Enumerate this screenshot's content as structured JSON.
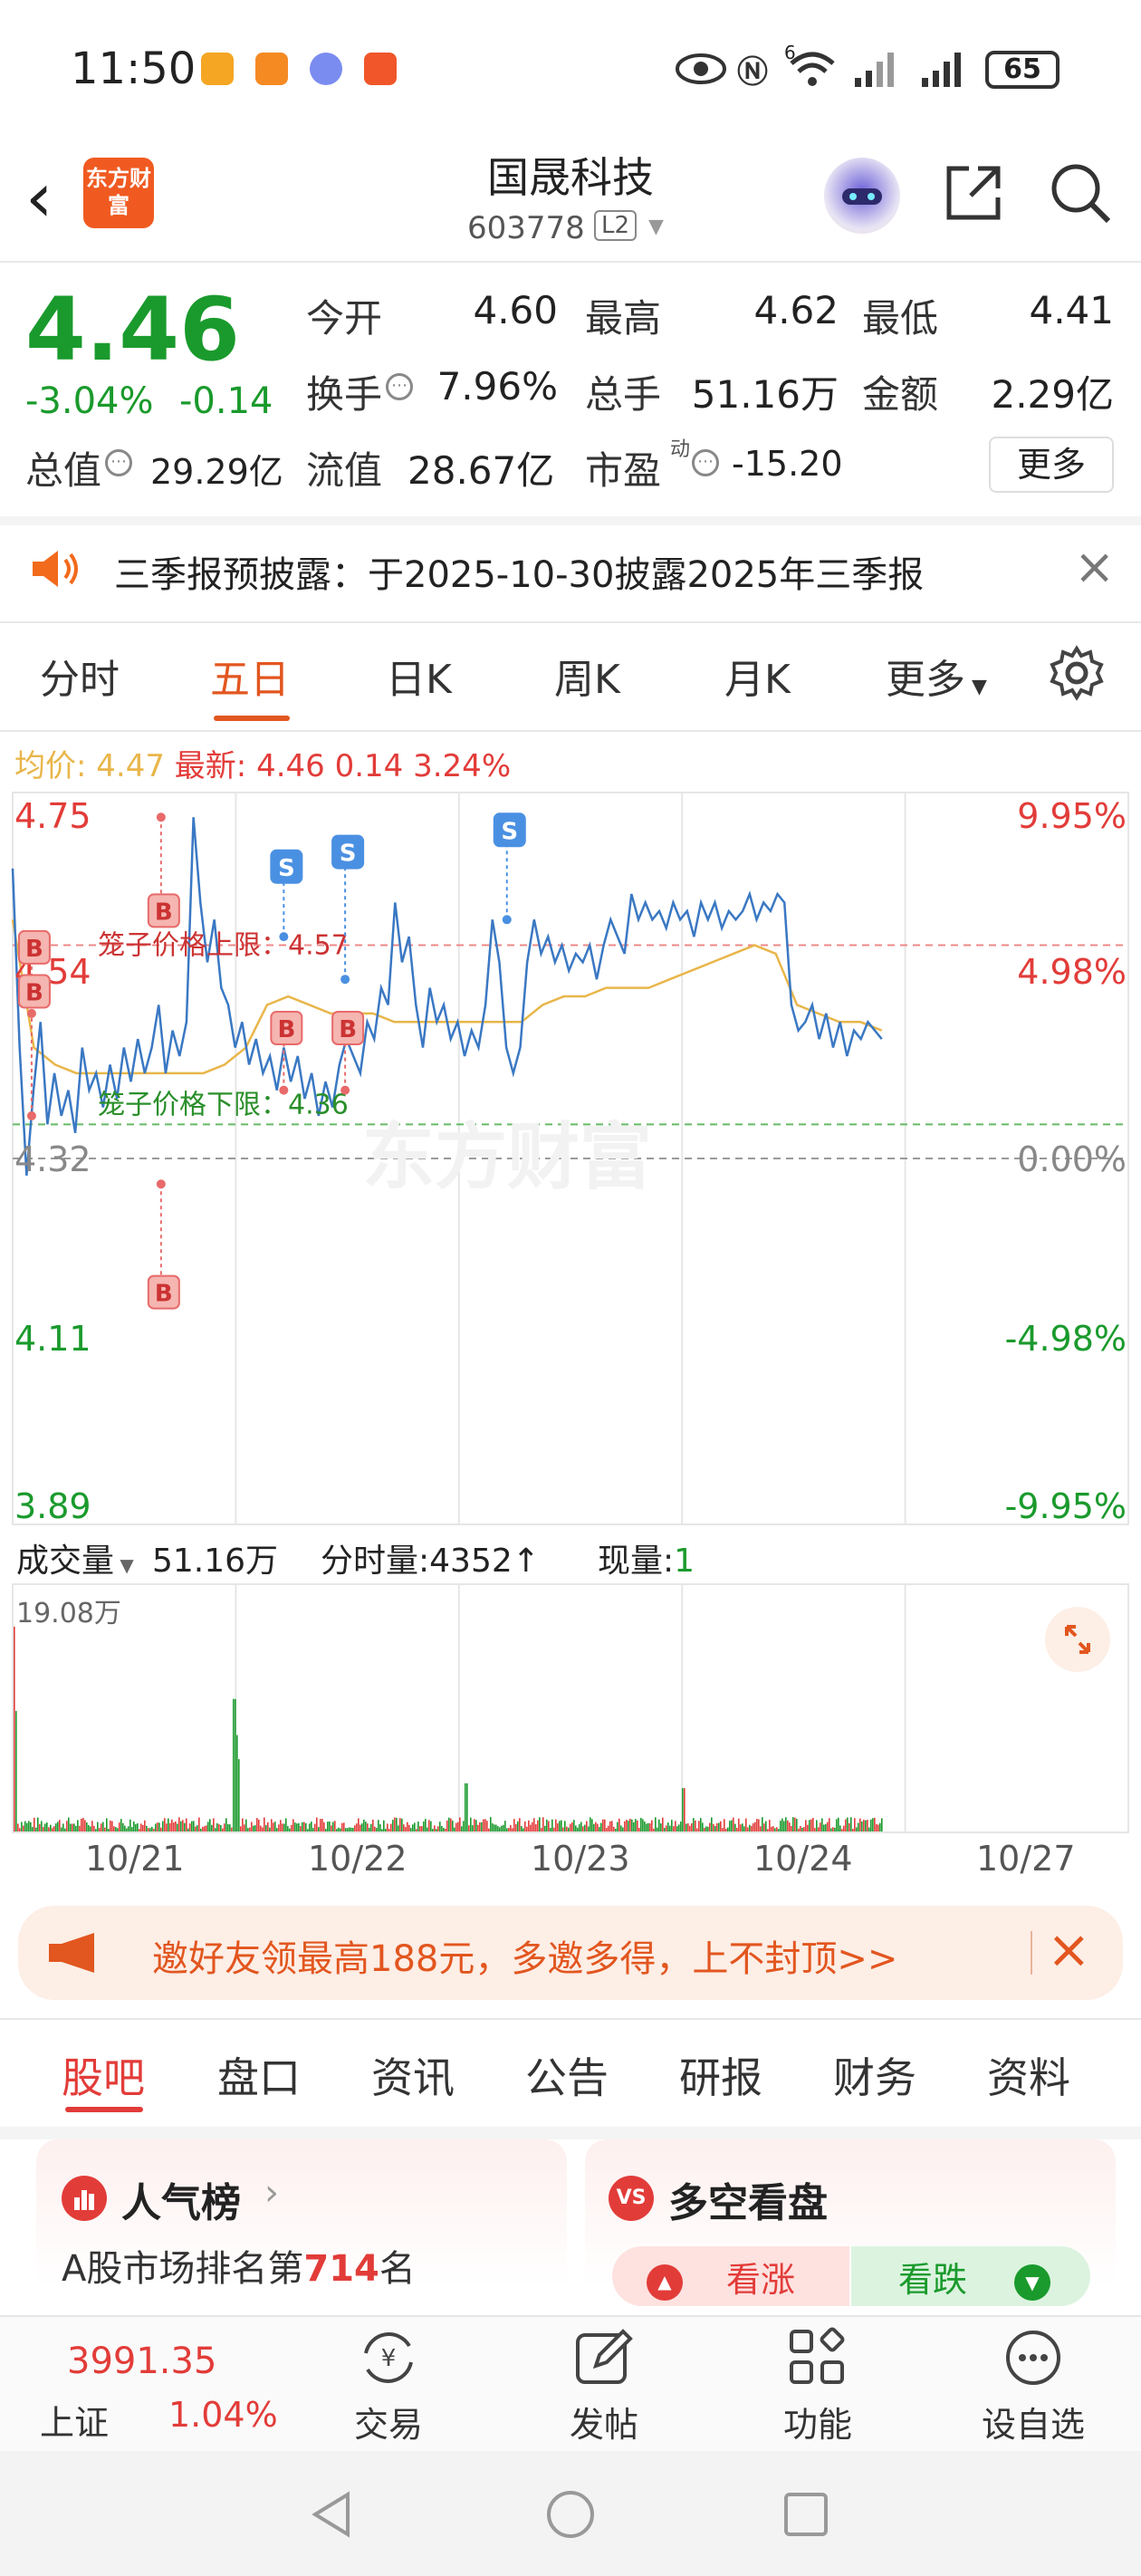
{
  "status_bar": {
    "time": "11:50",
    "network": "6",
    "battery": "65"
  },
  "header": {
    "logo_text": "东方财富",
    "stock_name": "国晟科技",
    "stock_code": "603778",
    "level_badge": "L2"
  },
  "quote": {
    "price": "4.46",
    "change_pct": "-3.04%",
    "change_abs": "-0.14",
    "fields": {
      "open_label": "今开",
      "open": "4.60",
      "high_label": "最高",
      "high": "4.62",
      "low_label": "最低",
      "low": "4.41",
      "turnover_label": "换手",
      "turnover": "7.96%",
      "volume_label": "总手",
      "volume": "51.16万",
      "amount_label": "金额",
      "amount": "2.29亿",
      "mcap_label": "总值",
      "mcap": "29.29亿",
      "float_label": "流值",
      "float": "28.67亿",
      "pe_label": "市盈",
      "pe_sup": "动",
      "pe": "-15.20"
    },
    "more_label": "更多"
  },
  "notice": {
    "text": "三季报预披露：于2025-10-30披露2025年三季报"
  },
  "chart_tabs": [
    "分时",
    "五日",
    "日K",
    "周K",
    "月K",
    "更多"
  ],
  "active_chart_tab": "五日",
  "price_chart": {
    "avg_label": "均价:",
    "avg_value": "4.47",
    "latest_label": "最新:",
    "latest_value": "4.46",
    "latest_change": "0.14",
    "latest_pct": "3.24%",
    "y_labels_left": [
      "4.75",
      "4.54",
      "4.32",
      "4.11",
      "3.89"
    ],
    "y_labels_right": [
      "9.95%",
      "4.98%",
      "0.00%",
      "-4.98%",
      "-9.95%"
    ],
    "upper_cage_label": "笼子价格上限：4.57",
    "lower_cage_label": "笼子价格下限：4.36",
    "watermark": "东方财富"
  },
  "chart_data": {
    "type": "line",
    "title": "",
    "xlabel": "",
    "ylabel": "",
    "x": [
      "10/21",
      "10/22",
      "10/23",
      "10/24",
      "10/27"
    ],
    "ylim": [
      3.89,
      4.75
    ],
    "prev_close": 4.32,
    "upper_cage": 4.57,
    "lower_cage": 4.36,
    "series": [],
    "price_path": [
      4.66,
      4.45,
      4.3,
      4.4,
      4.48,
      4.36,
      4.42,
      4.37,
      4.4,
      4.35,
      4.45,
      4.4,
      4.42,
      4.38,
      4.43,
      4.39,
      4.45,
      4.41,
      4.46,
      4.42,
      4.45,
      4.5,
      4.42,
      4.47,
      4.44,
      4.48,
      4.72,
      4.62,
      4.55,
      4.6,
      4.52,
      4.5,
      4.45,
      4.48,
      4.43,
      4.46,
      4.42,
      4.44,
      4.4,
      4.45,
      4.41,
      4.44,
      4.39,
      4.42,
      4.37,
      4.41,
      4.38,
      4.43,
      4.46,
      4.44,
      4.42,
      4.48,
      4.46,
      4.52,
      4.5,
      4.62,
      4.55,
      4.58,
      4.5,
      4.45,
      4.52,
      4.48,
      4.5,
      4.46,
      4.48,
      4.44,
      4.47,
      4.45,
      4.5,
      4.6,
      4.55,
      4.45,
      4.42,
      4.45,
      4.55,
      4.6,
      4.56,
      4.58,
      4.55,
      4.57,
      4.54,
      4.56,
      4.55,
      4.57,
      4.53,
      4.57,
      4.6,
      4.58,
      4.56,
      4.63,
      4.6,
      4.62,
      4.6,
      4.61,
      4.59,
      4.62,
      4.6,
      4.61,
      4.58,
      4.62,
      4.6,
      4.62,
      4.59,
      4.61,
      4.6,
      4.61,
      4.63,
      4.6,
      4.62,
      4.61,
      4.63,
      4.62,
      4.5,
      4.47,
      4.48,
      4.5,
      4.46,
      4.49,
      4.45,
      4.48,
      4.44,
      4.47,
      4.46,
      4.48,
      4.47,
      4.46
    ],
    "avg_path": [
      4.6,
      4.45,
      4.43,
      4.42,
      4.42,
      4.42,
      4.42,
      4.42,
      4.42,
      4.42,
      4.43,
      4.45,
      4.5,
      4.51,
      4.5,
      4.49,
      4.49,
      4.49,
      4.48,
      4.48,
      4.48,
      4.48,
      4.48,
      4.48,
      4.48,
      4.5,
      4.51,
      4.51,
      4.52,
      4.52,
      4.52,
      4.53,
      4.54,
      4.55,
      4.56,
      4.57,
      4.56,
      4.5,
      4.49,
      4.48,
      4.48,
      4.47
    ],
    "markers": [
      {
        "label": "B",
        "price": 4.49
      },
      {
        "label": "B",
        "price": 4.37
      },
      {
        "label": "B",
        "price": 4.72
      },
      {
        "label": "B",
        "price": 4.29
      },
      {
        "label": "S",
        "price": 4.58
      },
      {
        "label": "B",
        "price": 4.4
      },
      {
        "label": "S",
        "price": 4.53
      },
      {
        "label": "B",
        "price": 4.4
      },
      {
        "label": "S",
        "price": 4.6
      }
    ]
  },
  "volume_chart": {
    "mode_label": "成交量",
    "total": "51.16万",
    "tick_label": "分时量:",
    "tick_value": "4352↑",
    "current_label": "现量:",
    "current_value": "1",
    "max_label": "19.08万",
    "dates": [
      "10/21",
      "10/22",
      "10/23",
      "10/24",
      "10/27"
    ]
  },
  "promo": {
    "text": "邀好友领最高188元，多邀多得，上不封顶>>"
  },
  "sub_tabs": [
    "股吧",
    "盘口",
    "资讯",
    "公告",
    "研报",
    "财务",
    "资料"
  ],
  "cards": {
    "left_title": "人气榜",
    "left_line": "A股市场排名第",
    "left_rank": "714",
    "left_suffix": "名",
    "right_title": "多空看盘",
    "bull_label": "看涨",
    "bear_label": "看跌"
  },
  "bottom_nav": {
    "index_value": "3991.35",
    "index_name": "上证",
    "index_pct": "1.04%",
    "items": [
      "交易",
      "发帖",
      "功能",
      "设自选"
    ]
  },
  "colors": {
    "up": "#e23c39",
    "down": "#1a9a2c",
    "accent": "#e2561f",
    "line": "#3a78c3",
    "avg": "#e8b64a"
  }
}
